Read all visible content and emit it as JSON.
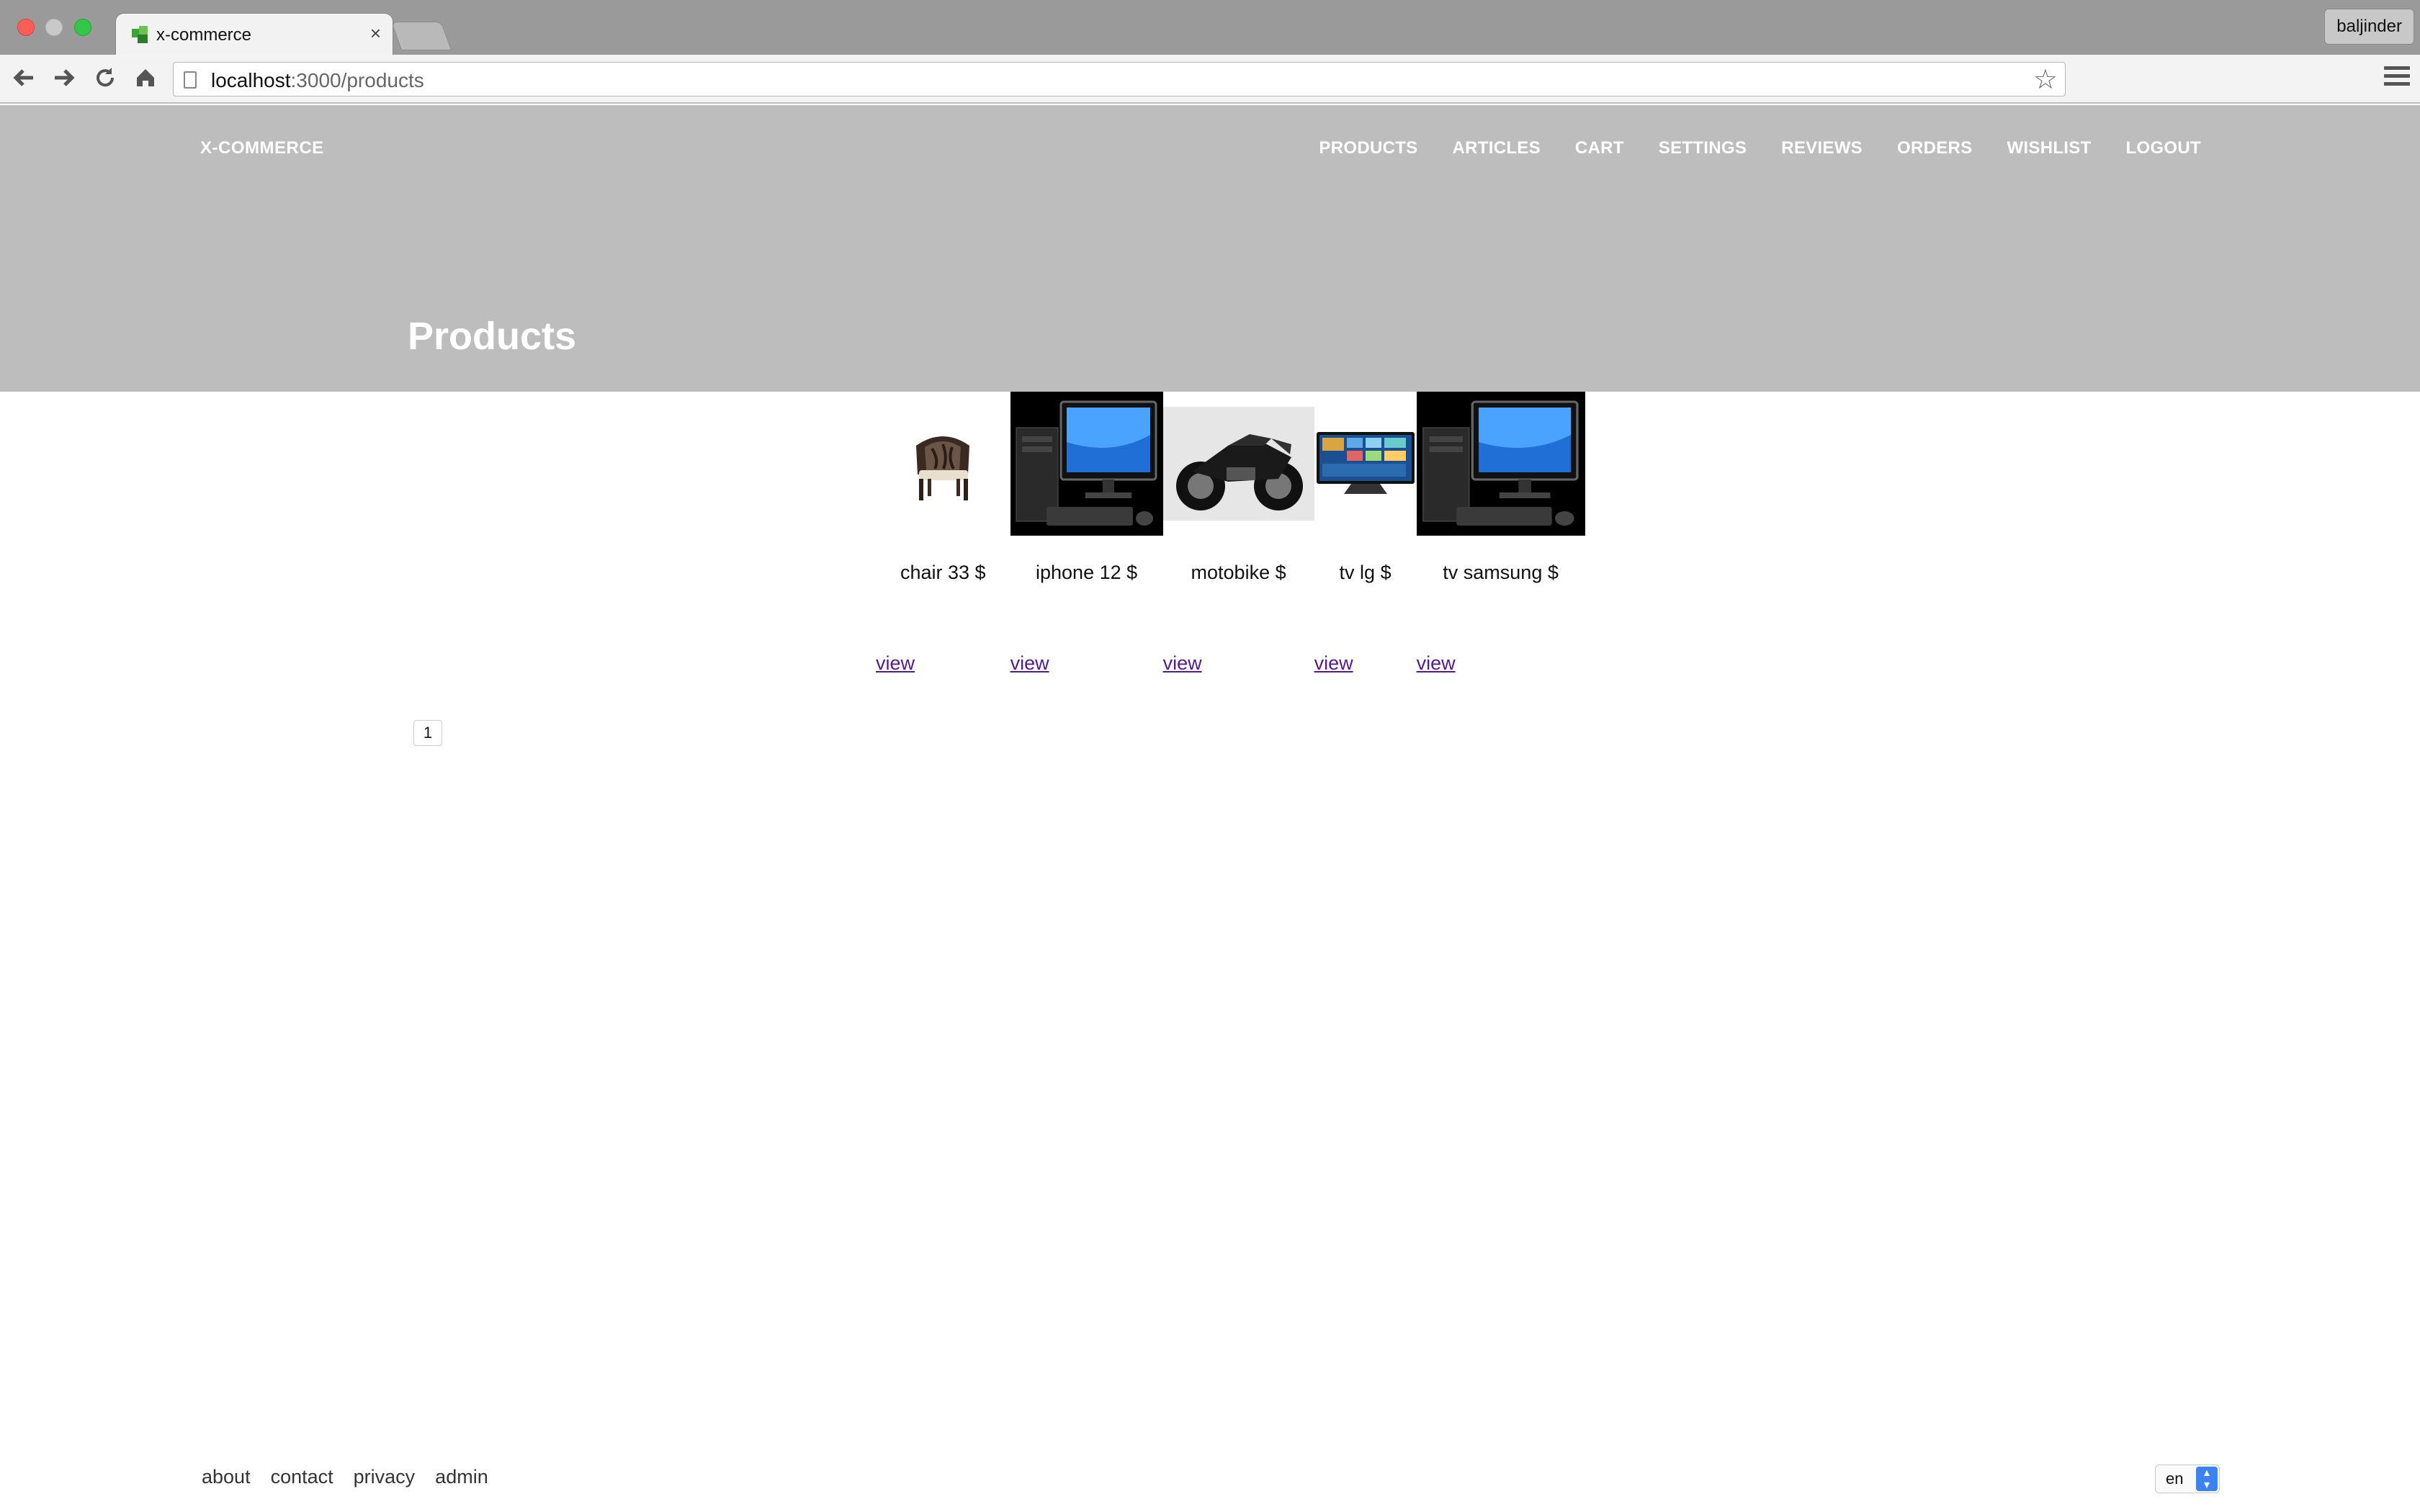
{
  "browser": {
    "tab_title": "x-commerce",
    "tab_close": "×",
    "profile_name": "baljinder",
    "url_host": "localhost",
    "url_path": ":3000/products",
    "back_icon": "arrow-left-icon",
    "forward_icon": "arrow-right-icon",
    "reload_icon": "reload-icon",
    "home_icon": "home-icon",
    "star_icon": "star-icon",
    "menu_icon": "hamburger-menu-icon"
  },
  "site": {
    "brand": "X-COMMERCE",
    "nav": [
      "PRODUCTS",
      "ARTICLES",
      "CART",
      "SETTINGS",
      "REVIEWS",
      "ORDERS",
      "WISHLIST",
      "LOGOUT"
    ],
    "page_title": "Products"
  },
  "products": [
    {
      "name": "chair 33 $",
      "link": "view",
      "image": "chair"
    },
    {
      "name": "iphone 12 $",
      "link": "view",
      "image": "desktop-computer"
    },
    {
      "name": "motobike $",
      "link": "view",
      "image": "motorbike"
    },
    {
      "name": "tv lg $",
      "link": "view",
      "image": "television"
    },
    {
      "name": "tv samsung $",
      "link": "view",
      "image": "desktop-computer"
    }
  ],
  "pagination": {
    "current_page": "1"
  },
  "footer": {
    "links": [
      "about",
      "contact",
      "privacy",
      "admin"
    ],
    "language": "en"
  },
  "colors": {
    "header_bg": "#bdbdbd",
    "link_visited": "#551a8b"
  }
}
